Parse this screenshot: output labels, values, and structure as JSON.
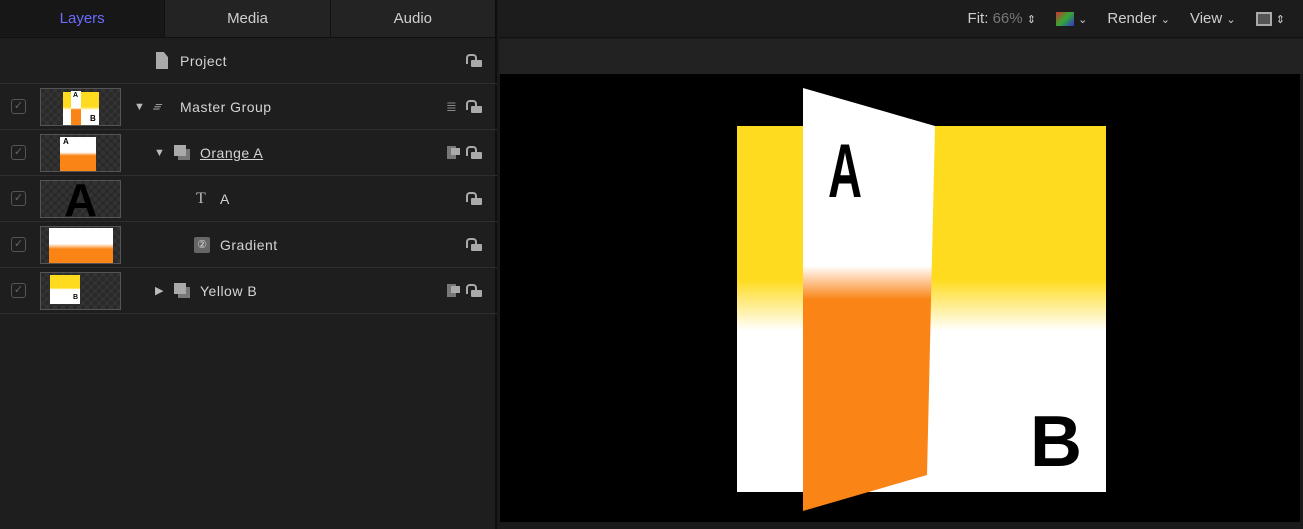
{
  "tabs": [
    {
      "label": "Layers"
    },
    {
      "label": "Media"
    },
    {
      "label": "Audio"
    }
  ],
  "layers": [
    {
      "name": "Project",
      "icon": "document-icon"
    },
    {
      "name": "Master Group",
      "icon": "group-stack-icon",
      "expanded": true,
      "enabled": true
    },
    {
      "name": "Orange A",
      "icon": "group-icon",
      "expanded": true,
      "enabled": true
    },
    {
      "name": "A",
      "icon": "text-icon",
      "enabled": true
    },
    {
      "name": "Gradient",
      "icon": "generator-icon",
      "enabled": true
    },
    {
      "name": "Yellow B",
      "icon": "group-icon",
      "expanded": false,
      "enabled": true
    }
  ],
  "toolbar": {
    "fit_label": "Fit:",
    "fit_value": "66%",
    "render": "Render",
    "view": "View"
  },
  "canvas": {
    "letter_a": "A",
    "letter_b": "B"
  },
  "colors": {
    "accent": "#6b6bff",
    "yellow": "#ffdb1f",
    "orange": "#fa8416"
  }
}
